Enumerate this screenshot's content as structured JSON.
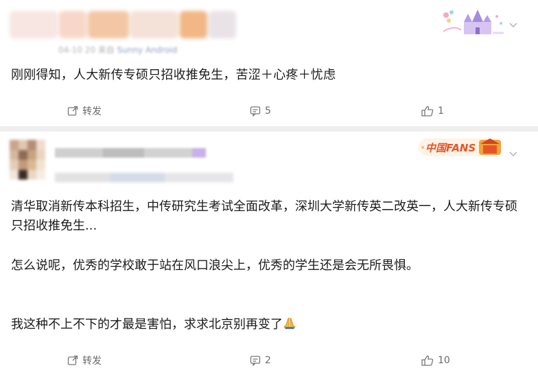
{
  "posts": [
    {
      "meta": {
        "date": "04-10 20",
        "source_prefix": "来自",
        "source": "Sunny Android"
      },
      "body": "刚刚得知，人大新传专硕只招收推免生，苦涩＋心疼＋忧虑",
      "actions": {
        "repost_label": "转发",
        "comments": "5",
        "likes": "1"
      },
      "badge_icon": "castle-badge-icon"
    },
    {
      "paragraphs": [
        "清华取消新传本科招生，中传研究生考试全面改革，深圳大学新传英二改英一，人大新传专硕只招收推免生...",
        "怎么说呢，优秀的学校敢于站在风口浪尖上，优秀的学生还是会无所畏惧。",
        "我这种不上不下的才最是害怕，求求北京别再变了"
      ],
      "emoji_icon": "praying-hands-icon",
      "badge_text": "中国FANS",
      "actions": {
        "repost_label": "转发",
        "comments": "2",
        "likes": "10"
      }
    }
  ],
  "colors": {
    "separator": "#eeeeee",
    "action_text": "#6a6a6a",
    "body_text": "#1b1b1b",
    "source_link": "#6e7fb3",
    "fans_badge": "#e8542a"
  }
}
